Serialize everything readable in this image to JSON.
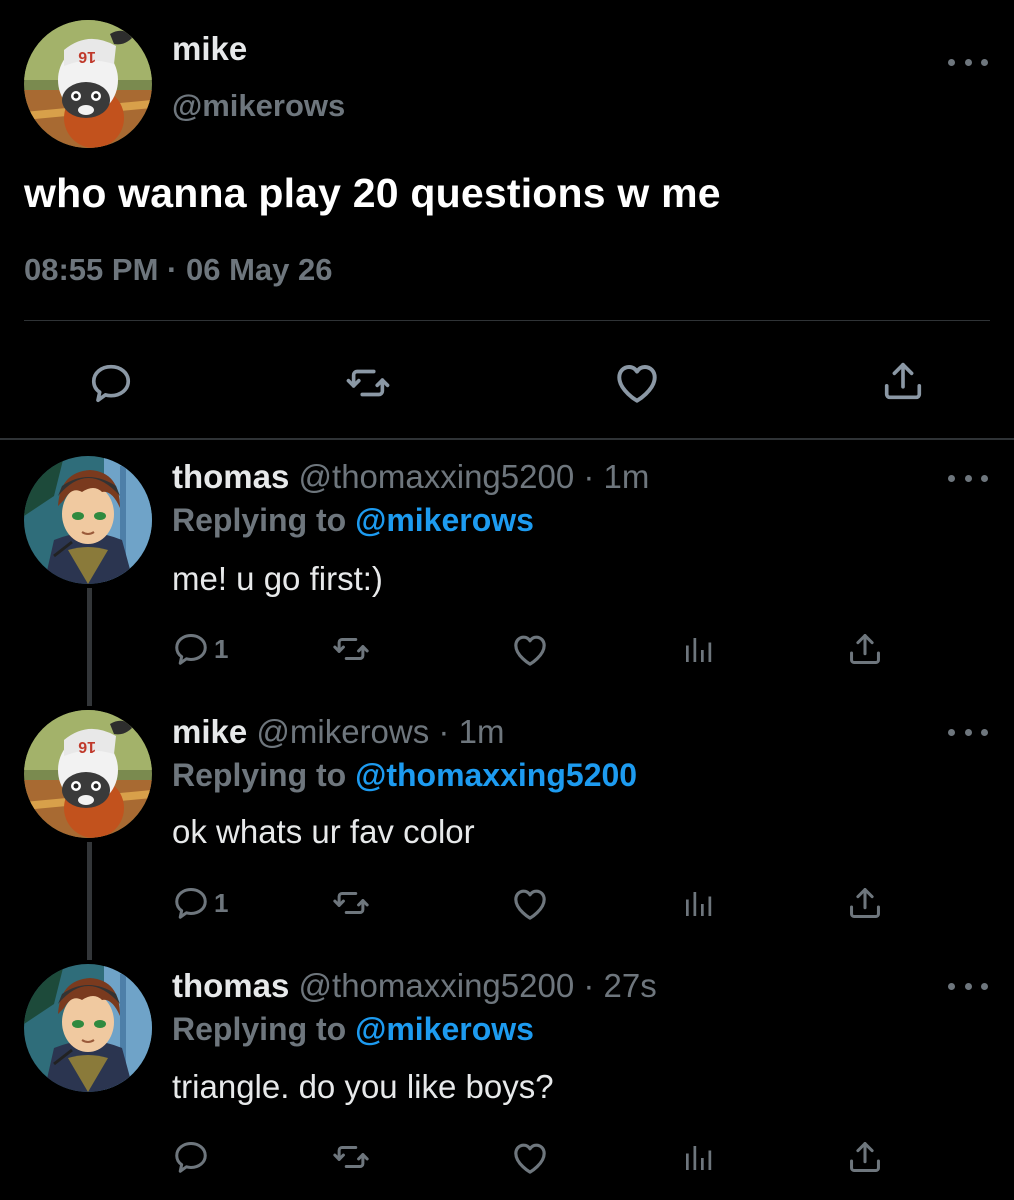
{
  "main_tweet": {
    "name": "mike",
    "handle": "@mikerows",
    "text": "who wanna play 20 questions w me",
    "time": "08:55 PM",
    "date_sep": "·",
    "date": "06 May 26",
    "actions": [
      "reply-icon",
      "retweet-icon",
      "like-icon",
      "share-icon"
    ]
  },
  "replies": [
    {
      "name": "thomas",
      "handle": "@thomaxxing5200",
      "sep": "·",
      "time": "1m",
      "replying_prefix": "Replying to",
      "replying_to": "@mikerows",
      "text": "me! u go first:)",
      "reply_count": "1"
    },
    {
      "name": "mike",
      "handle": "@mikerows",
      "sep": "·",
      "time": "1m",
      "replying_prefix": "Replying to",
      "replying_to": "@thomaxxing5200",
      "text": "ok whats ur fav color",
      "reply_count": "1"
    },
    {
      "name": "thomas",
      "handle": "@thomaxxing5200",
      "sep": "·",
      "time": "27s",
      "replying_prefix": "Replying to",
      "replying_to": "@mikerows",
      "text": "triangle. do you like boys?",
      "reply_count": ""
    }
  ],
  "colors": {
    "background": "#000000",
    "text": "#e7e9ea",
    "muted": "#6e767d",
    "link": "#1d9bf0",
    "divider": "#2f3336"
  }
}
